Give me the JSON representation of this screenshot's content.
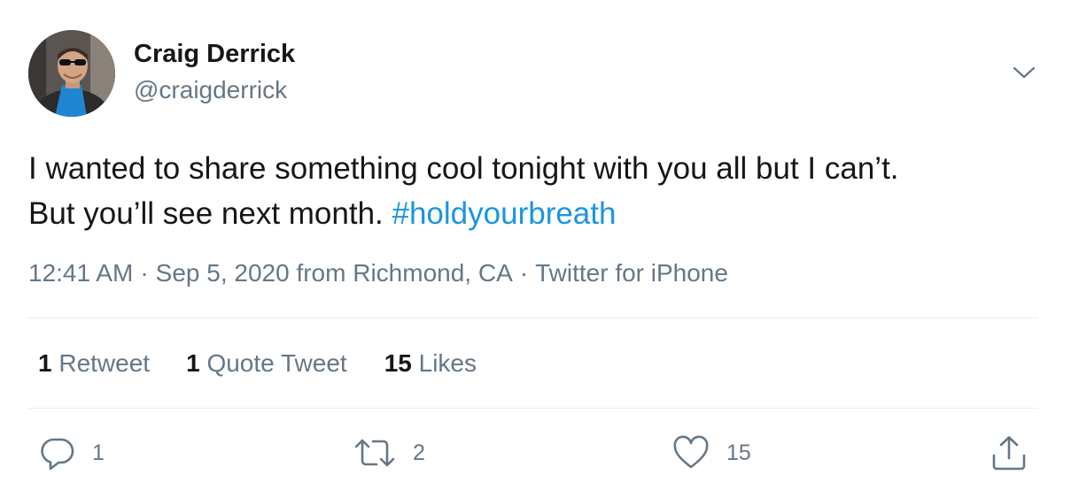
{
  "author": {
    "display_name": "Craig Derrick",
    "handle": "@craigderrick"
  },
  "tweet": {
    "text_line1": "I wanted to share something cool tonight with you all but I can’t.",
    "text_line2_prefix": "But you’ll see next month. ",
    "hashtag": "#holdyourbreath"
  },
  "meta": {
    "time": "12:41 AM",
    "separator": "·",
    "date": "Sep 5, 2020",
    "from_label": "from",
    "location": "Richmond, CA",
    "source": "Twitter for iPhone"
  },
  "stats": {
    "retweets": {
      "count": "1",
      "label": "Retweet"
    },
    "quote_tweets": {
      "count": "1",
      "label": "Quote Tweet"
    },
    "likes": {
      "count": "15",
      "label": "Likes"
    }
  },
  "actions": {
    "reply": {
      "icon": "reply-icon",
      "count": "1"
    },
    "retweet": {
      "icon": "retweet-icon",
      "count": "2"
    },
    "like": {
      "icon": "heart-icon",
      "count": "15"
    },
    "share": {
      "icon": "share-icon"
    }
  },
  "colors": {
    "text": "#14171a",
    "secondary": "#657786",
    "link": "#1b95e0",
    "divider": "#e6ecf0"
  }
}
